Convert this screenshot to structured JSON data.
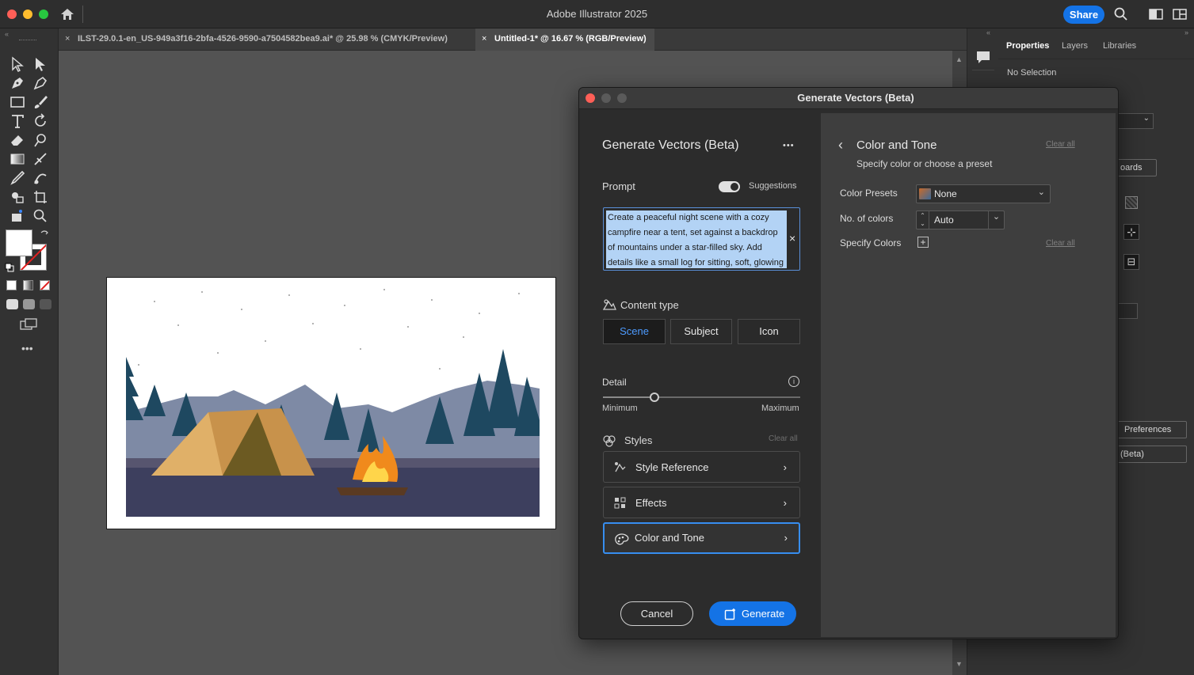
{
  "window": {
    "title": "Adobe Illustrator 2025",
    "share_label": "Share"
  },
  "tabs": [
    {
      "label": "ILST-29.0.1-en_US-949a3f16-2bfa-4526-9590-a7504582bea9.ai* @ 25.98 % (CMYK/Preview)",
      "close": "×"
    },
    {
      "label": "Untitled-1* @ 16.67 % (RGB/Preview)",
      "close": "×"
    }
  ],
  "properties_panel": {
    "tabs": [
      "Properties",
      "Layers",
      "Libraries"
    ],
    "selection": "No Selection",
    "artboards_partial": "oards",
    "preferences_partial": "Preferences",
    "beta_partial": "(Beta)"
  },
  "dialog": {
    "window_title": "Generate Vectors (Beta)",
    "heading": "Generate Vectors (Beta)",
    "more": "•••",
    "prompt_label": "Prompt",
    "suggestions_label": "Suggestions",
    "prompt_text": "Create a peaceful night scene with a cozy campfire near a tent, set against a backdrop of mountains under a star-filled sky. Add details like a small log for sitting, soft, glowing",
    "clear_prompt": "×",
    "content_type_label": "Content type",
    "content_types": [
      "Scene",
      "Subject",
      "Icon"
    ],
    "detail_label": "Detail",
    "detail_info": "i",
    "detail_min": "Minimum",
    "detail_max": "Maximum",
    "detail_value": 0.26,
    "styles_label": "Styles",
    "styles_clear": "Clear all",
    "style_rows": [
      {
        "label": "Style Reference",
        "icon": "style-reference-icon"
      },
      {
        "label": "Effects",
        "icon": "effects-icon"
      },
      {
        "label": "Color and Tone",
        "icon": "palette-icon"
      }
    ],
    "chevron": "›",
    "cancel_label": "Cancel",
    "generate_label": "Generate",
    "color_tone": {
      "back": "‹",
      "title": "Color and Tone",
      "clear_all": "Clear all",
      "subtitle": "Specify color or choose a preset",
      "presets_label": "Color Presets",
      "presets_value": "None",
      "num_colors_label": "No. of colors",
      "num_colors_value": "Auto",
      "specify_label": "Specify Colors",
      "specify_clear": "Clear all"
    }
  }
}
